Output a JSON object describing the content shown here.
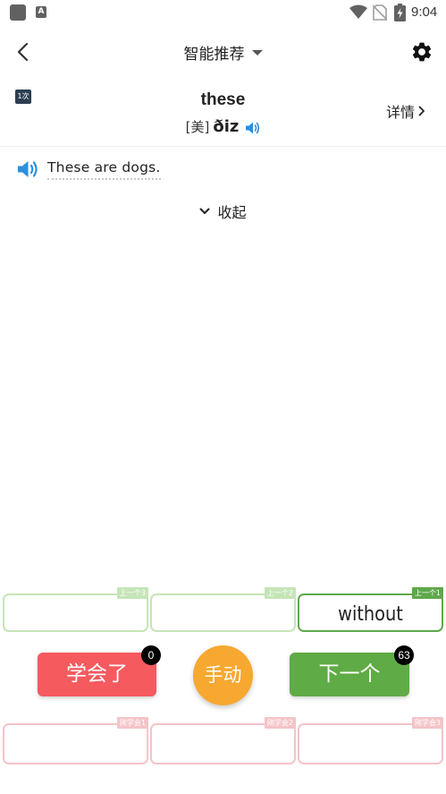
{
  "status_bar": {
    "time": "9:04",
    "notification_icon": "A",
    "icons": [
      "app-square-icon",
      "accessibility-a-icon",
      "wifi-icon",
      "no-sim-icon",
      "battery-charging-icon"
    ]
  },
  "header": {
    "title": "智能推荐",
    "back_icon": "back-arrow-icon",
    "settings_icon": "gear-icon"
  },
  "word_card": {
    "review_count": "1次",
    "word": "these",
    "phonetic_label": "[美]",
    "phonetic": "ðiz",
    "detail_label": "详情"
  },
  "example": {
    "sentence": "These are dogs.",
    "collapse_label": "收起"
  },
  "history": [
    {
      "tag": "上一个3",
      "word": ""
    },
    {
      "tag": "上一个2",
      "word": ""
    },
    {
      "tag": "上一个1",
      "word": "without"
    }
  ],
  "actions": {
    "learned_label": "学会了",
    "learned_count": "0",
    "manual_label": "手动",
    "next_label": "下一个",
    "next_count": "63"
  },
  "learned_history": [
    {
      "tag": "刚学会1"
    },
    {
      "tag": "刚学会2"
    },
    {
      "tag": "刚学会3"
    }
  ],
  "colors": {
    "learned_button": "#f55a5f",
    "manual_button": "#f7a830",
    "next_button": "#5fab46",
    "speaker_blue": "#2b8fe0",
    "history_border": "#c5e5b8",
    "history_active_border": "#5fa84a",
    "learned_border": "#f4c4c8"
  }
}
